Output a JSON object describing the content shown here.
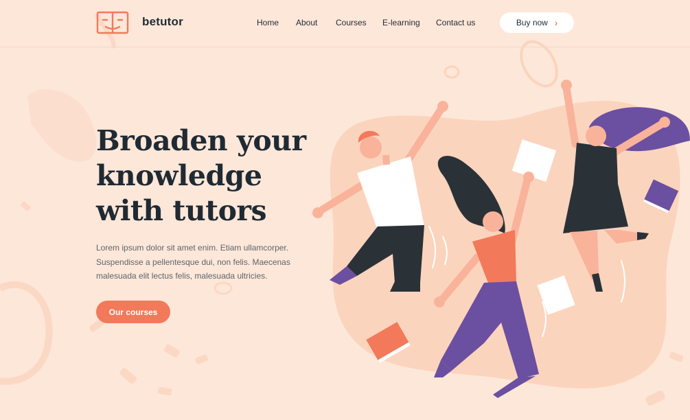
{
  "brand": {
    "name": "betutor",
    "logo_icon": "open-book-face-icon"
  },
  "nav": {
    "items": [
      {
        "label": "Home"
      },
      {
        "label": "About"
      },
      {
        "label": "Courses"
      },
      {
        "label": "E-learning"
      },
      {
        "label": "Contact us"
      }
    ],
    "buy_label": "Buy now",
    "buy_icon": "chevron-right-icon"
  },
  "hero": {
    "title_lines": [
      "Broaden your",
      "knowledge",
      "with tutors"
    ],
    "desc_lines": [
      "Lorem ipsum dolor sit amet enim. Etiam ullamcorper.",
      "Suspendisse a pellentesque dui, non felis. Maecenas",
      "malesuada elit lectus felis, malesuada ultricies."
    ],
    "cta_label": "Our courses"
  },
  "colors": {
    "background": "#fde7d9",
    "accent": "#f2795a",
    "dark": "#1f2a33",
    "purple": "#6b4fa0",
    "blob": "#fbd4bd"
  }
}
